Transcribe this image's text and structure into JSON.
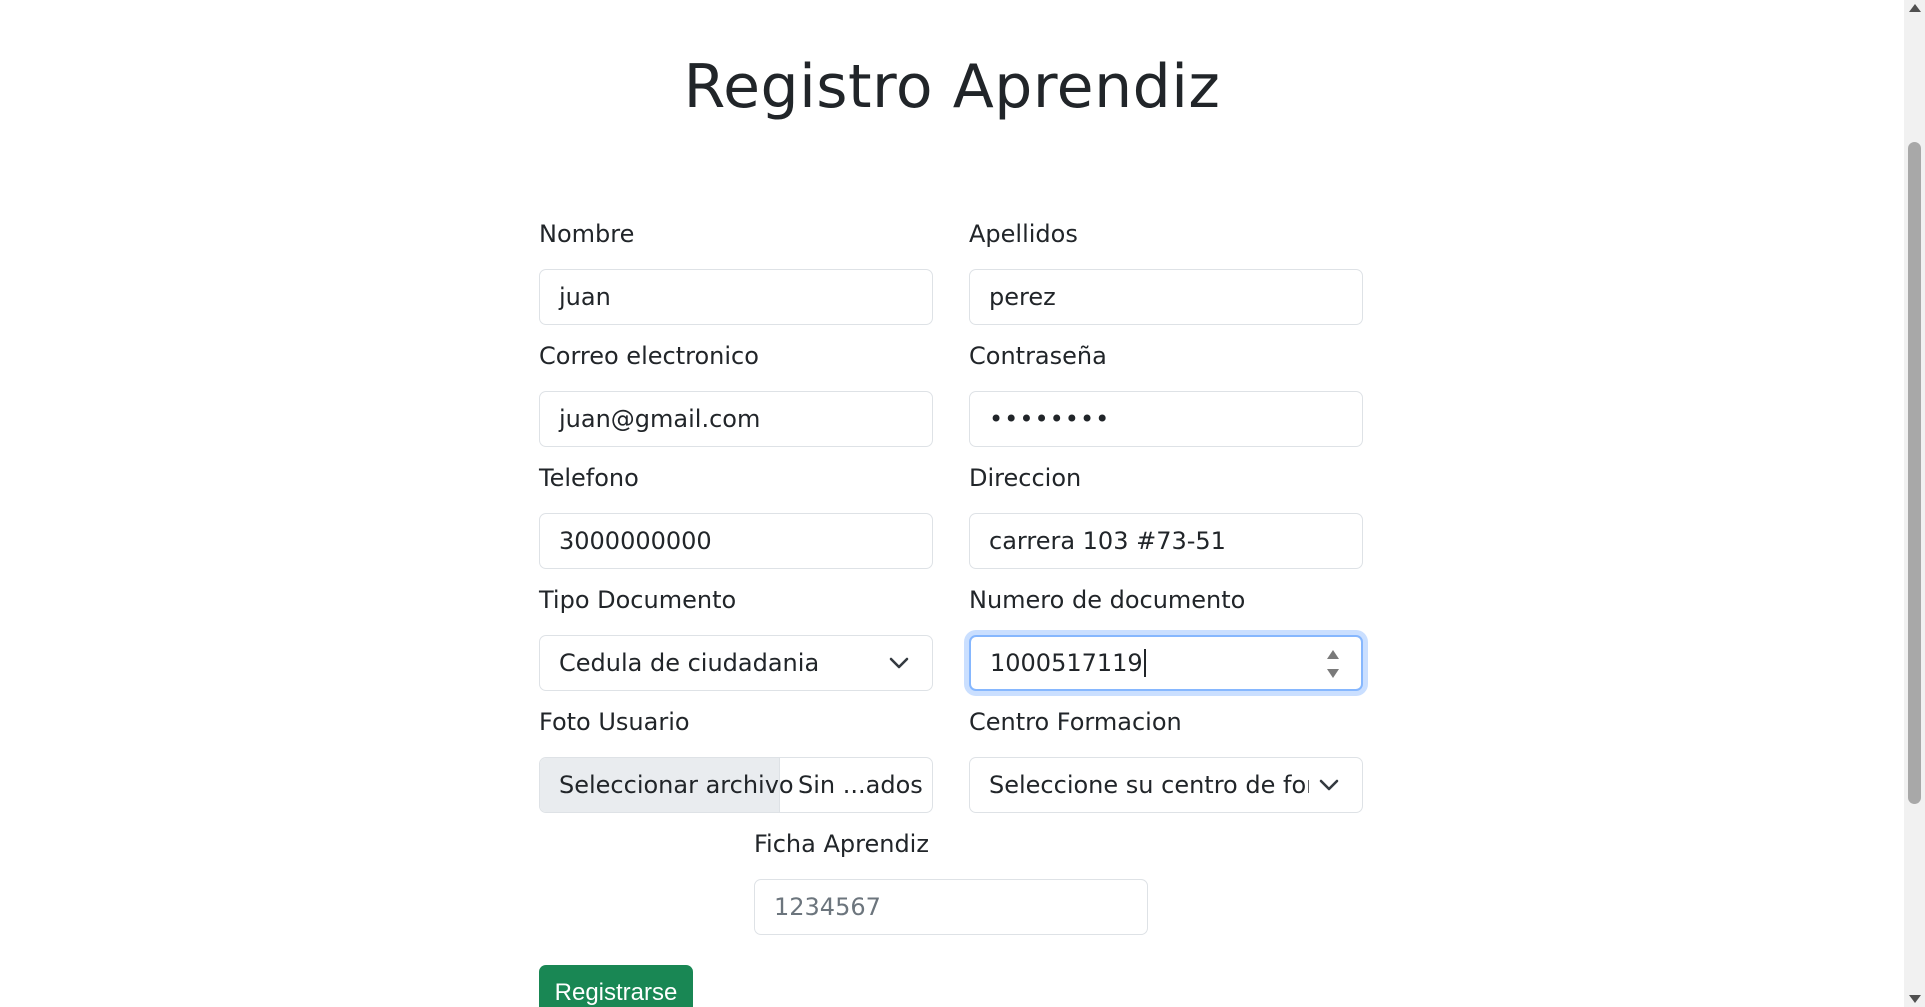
{
  "page": {
    "title": "Registro Aprendiz"
  },
  "form": {
    "nombre": {
      "label": "Nombre",
      "value": "juan"
    },
    "apellidos": {
      "label": "Apellidos",
      "value": "perez"
    },
    "correo": {
      "label": "Correo electronico",
      "value": "juan@gmail.com"
    },
    "contrasena": {
      "label": "Contraseña",
      "value": "••••••••"
    },
    "telefono": {
      "label": "Telefono",
      "value": "3000000000"
    },
    "direccion": {
      "label": "Direccion",
      "value": "carrera 103 #73-51"
    },
    "tipo_documento": {
      "label": "Tipo Documento",
      "selected": "Cedula de ciudadania",
      "icon": "chevron-down-icon"
    },
    "numero_documento": {
      "label": "Numero de documento",
      "value": "1000517119",
      "icon": "spinner-icon"
    },
    "foto_usuario": {
      "label": "Foto Usuario",
      "button": "Seleccionar archivo",
      "filename": "Sin ...ados"
    },
    "centro_formacion": {
      "label": "Centro Formacion",
      "selected": "Seleccione su centro de forma",
      "icon": "chevron-down-icon"
    },
    "ficha": {
      "label": "Ficha Aprendiz",
      "placeholder": "1234567"
    }
  },
  "actions": {
    "submit_label": "Registrarse"
  },
  "colors": {
    "submit": "#198754",
    "focus_ring": "#86b7fe",
    "border": "#dee2e6"
  }
}
